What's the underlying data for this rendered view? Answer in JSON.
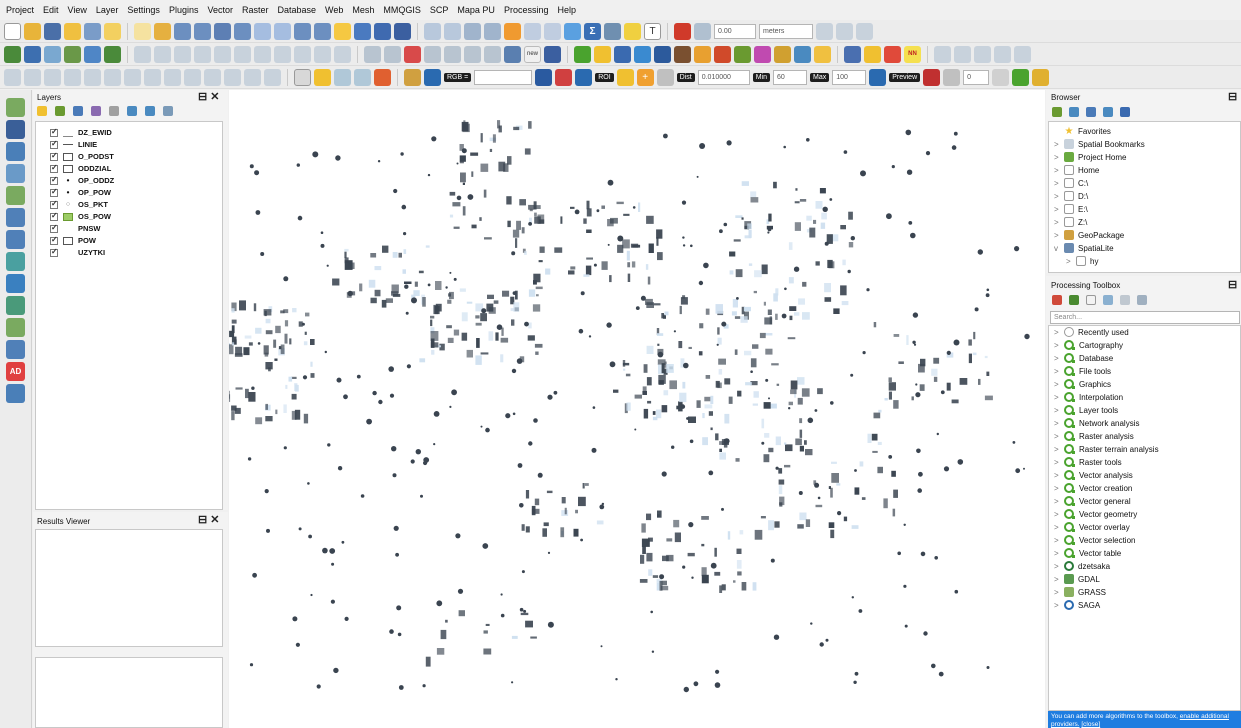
{
  "menu": [
    "Project",
    "Edit",
    "View",
    "Layer",
    "Settings",
    "Plugins",
    "Vector",
    "Raster",
    "Database",
    "Web",
    "Mesh",
    "MMQGIS",
    "SCP",
    "Mapa PU",
    "Processing",
    "Help"
  ],
  "toolbar": {
    "scale_value": "0.00",
    "units": "meters",
    "rgb_select": "RGB =",
    "roi_label": "ROI",
    "dist_label": "Dist",
    "dist_value": "0.010000",
    "min_label": "Min",
    "min_value": "60",
    "max_label": "Max",
    "max_value": "100",
    "preview_label": "Preview",
    "t_value": "0",
    "nn_label": "NN"
  },
  "layers_panel": {
    "title": "Layers",
    "layers": [
      "DZ_EWID",
      "LINIE",
      "O_PODST",
      "ODDZIAL",
      "OP_ODDZ",
      "OP_POW",
      "OS_PKT",
      "OS_POW",
      "PNSW",
      "POW",
      "UZYTKI"
    ]
  },
  "results_panel": {
    "title": "Results Viewer"
  },
  "browser_panel": {
    "title": "Browser",
    "items": [
      "Favorites",
      "Spatial Bookmarks",
      "Project Home",
      "Home",
      "C:\\",
      "D:\\",
      "E:\\",
      "Z:\\",
      "GeoPackage",
      "SpatiaLite",
      "hy"
    ]
  },
  "toolbox_panel": {
    "title": "Processing Toolbox",
    "search_placeholder": "Search...",
    "items": [
      "Recently used",
      "Cartography",
      "Database",
      "File tools",
      "Graphics",
      "Interpolation",
      "Layer tools",
      "Network analysis",
      "Raster analysis",
      "Raster terrain analysis",
      "Raster tools",
      "Vector analysis",
      "Vector creation",
      "Vector general",
      "Vector geometry",
      "Vector overlay",
      "Vector selection",
      "Vector table",
      "dzetsaka",
      "GDAL",
      "GRASS",
      "SAGA"
    ],
    "footer_text": "You can add more algorithms to the toolbox,",
    "footer_link": "enable additional",
    "footer_text2": "providers.",
    "footer_close": "[close]"
  },
  "colors": {
    "accent": "#1f7de0",
    "qgis_green": "#4aa32e",
    "map_feature": "#3a4450"
  }
}
